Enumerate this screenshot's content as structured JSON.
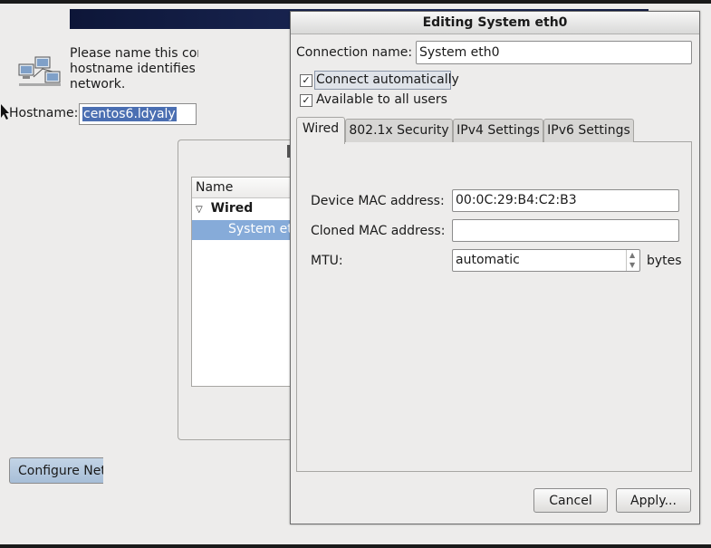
{
  "background": {
    "prompt_lines": [
      "Please name this com",
      "hostname identifies th",
      "network."
    ],
    "hostname_label": "Hostname:",
    "hostname_value": "centos6.ldyaly",
    "list_header": "Name",
    "list_group": "Wired",
    "list_item": "System et",
    "configure_button": "Configure Netv"
  },
  "dialog": {
    "title": "Editing System eth0",
    "connection_name_label": "Connection name:",
    "connection_name_value": "System eth0",
    "connect_automatically": {
      "label": "Connect automatically",
      "checked": "✓"
    },
    "available_to_all": {
      "label": "Available to all users",
      "checked": "✓"
    },
    "tabs": [
      {
        "label": "Wired",
        "active": true
      },
      {
        "label": "802.1x Security"
      },
      {
        "label": "IPv4 Settings"
      },
      {
        "label": "IPv6 Settings"
      }
    ],
    "wired": {
      "device_mac_label": "Device MAC address:",
      "device_mac_value": "00:0C:29:B4:C2:B3",
      "cloned_mac_label": "Cloned MAC address:",
      "cloned_mac_value": "",
      "mtu_label": "MTU:",
      "mtu_value": "automatic",
      "mtu_unit": "bytes"
    },
    "cancel_button": "Cancel",
    "apply_button": "Apply..."
  },
  "icons": {
    "network": "network-computers-icon",
    "cursor": "mouse-pointer-icon",
    "expander": "triangle-down-icon",
    "spin_up": "▲",
    "spin_down": "▼"
  }
}
